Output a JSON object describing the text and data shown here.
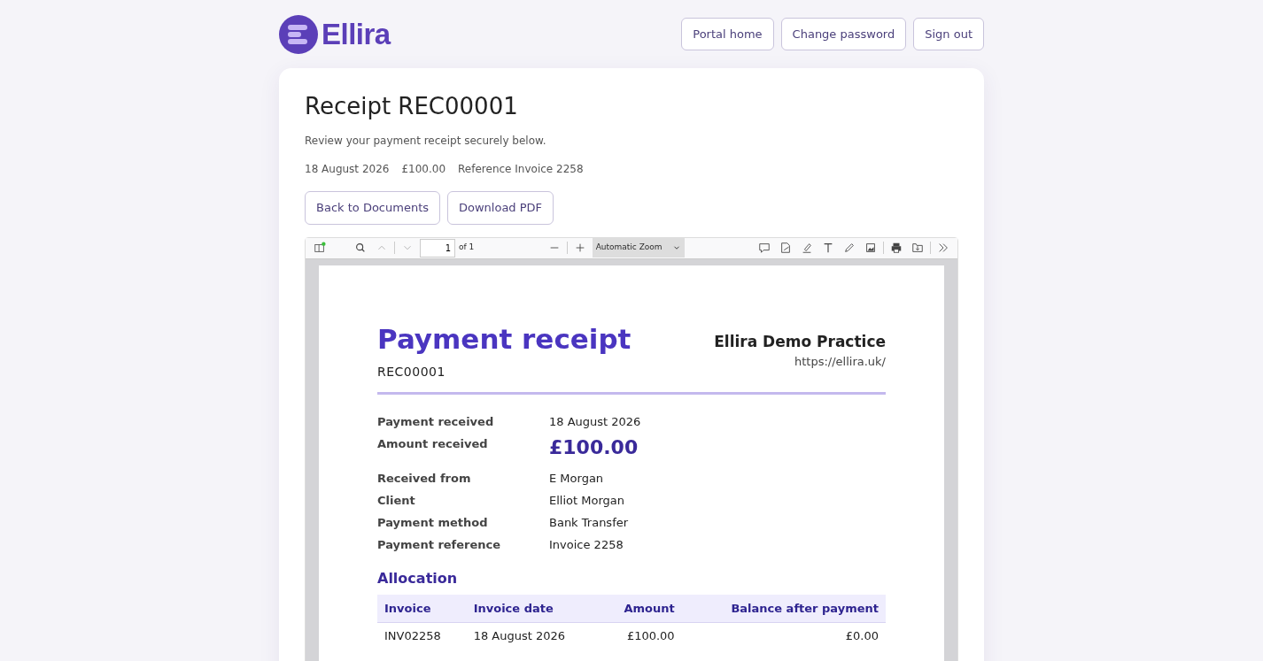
{
  "header": {
    "logo_text": "Ellira",
    "nav_buttons": [
      "Portal home",
      "Change password",
      "Sign out"
    ]
  },
  "page": {
    "title": "Receipt REC00001",
    "subtitle": "Review your payment receipt securely below.",
    "meta": [
      "18 August 2026",
      "£100.00",
      "Reference Invoice 2258"
    ],
    "actions": [
      "Back to Documents",
      "Download PDF"
    ]
  },
  "viewer": {
    "toolbar": {
      "page_number": "1",
      "page_count": "of 1",
      "zoom": "Automatic Zoom"
    },
    "document": {
      "title": "Payment receipt",
      "number": "REC00001",
      "practice_name": "Ellira Demo Practice",
      "practice_url": "https://ellira.uk/",
      "details": [
        {
          "label": "Payment received",
          "value": "18 August 2026",
          "kind": "text"
        },
        {
          "label": "Amount received",
          "value": "£100.00",
          "kind": "amount"
        },
        {
          "label": "Received from",
          "value": "E Morgan",
          "kind": "text"
        },
        {
          "label": "Client",
          "value": "Elliot Morgan",
          "kind": "text"
        },
        {
          "label": "Payment method",
          "value": "Bank Transfer",
          "kind": "text"
        },
        {
          "label": "Payment reference",
          "value": "Invoice 2258",
          "kind": "text"
        }
      ],
      "allocation_title": "Allocation",
      "table": {
        "columns": [
          "Invoice",
          "Invoice date",
          "Amount",
          "Balance after payment"
        ],
        "rows": [
          [
            "INV02258",
            "18 August 2026",
            "£100.00",
            "£0.00"
          ]
        ]
      }
    }
  }
}
